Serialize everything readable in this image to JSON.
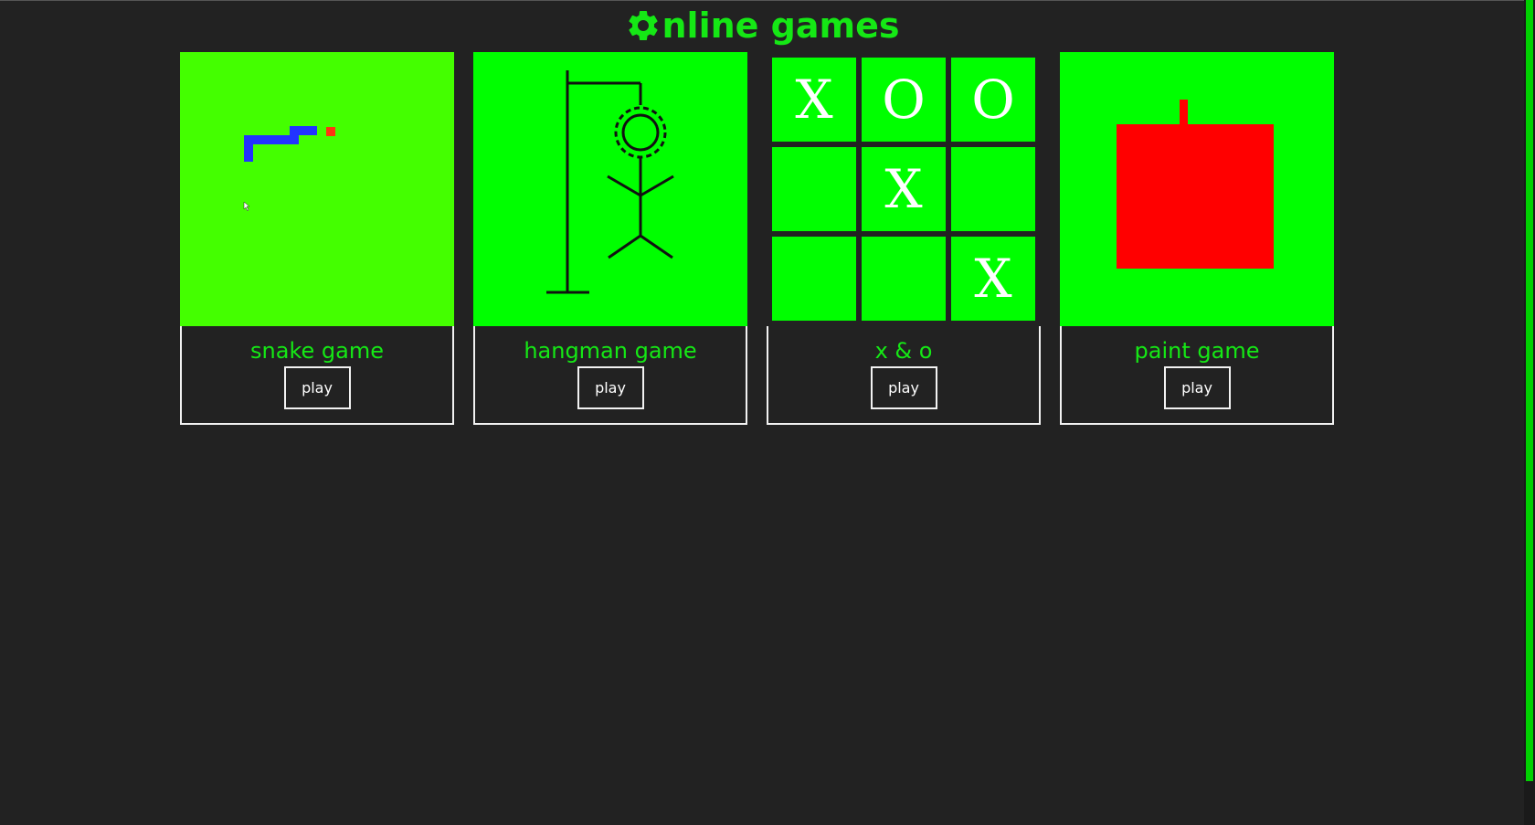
{
  "header": {
    "title": "nline games"
  },
  "colors": {
    "accent": "#15e815",
    "background": "#222222",
    "snake_bg": "#44ff00",
    "game_bg": "#00ff00",
    "snake": "#2233ff",
    "food": "#ff3311",
    "apple": "#ff0000"
  },
  "games": [
    {
      "title": "snake game",
      "play_label": "play",
      "preview_icon": "snake-preview"
    },
    {
      "title": "hangman game",
      "play_label": "play",
      "preview_icon": "hangman-preview"
    },
    {
      "title": "x & o",
      "play_label": "play",
      "preview_icon": "tic-tac-toe-preview",
      "board": [
        "X",
        "O",
        "O",
        "",
        "X",
        "",
        "",
        "",
        "X"
      ]
    },
    {
      "title": "paint game",
      "play_label": "play",
      "preview_icon": "paint-preview"
    }
  ]
}
